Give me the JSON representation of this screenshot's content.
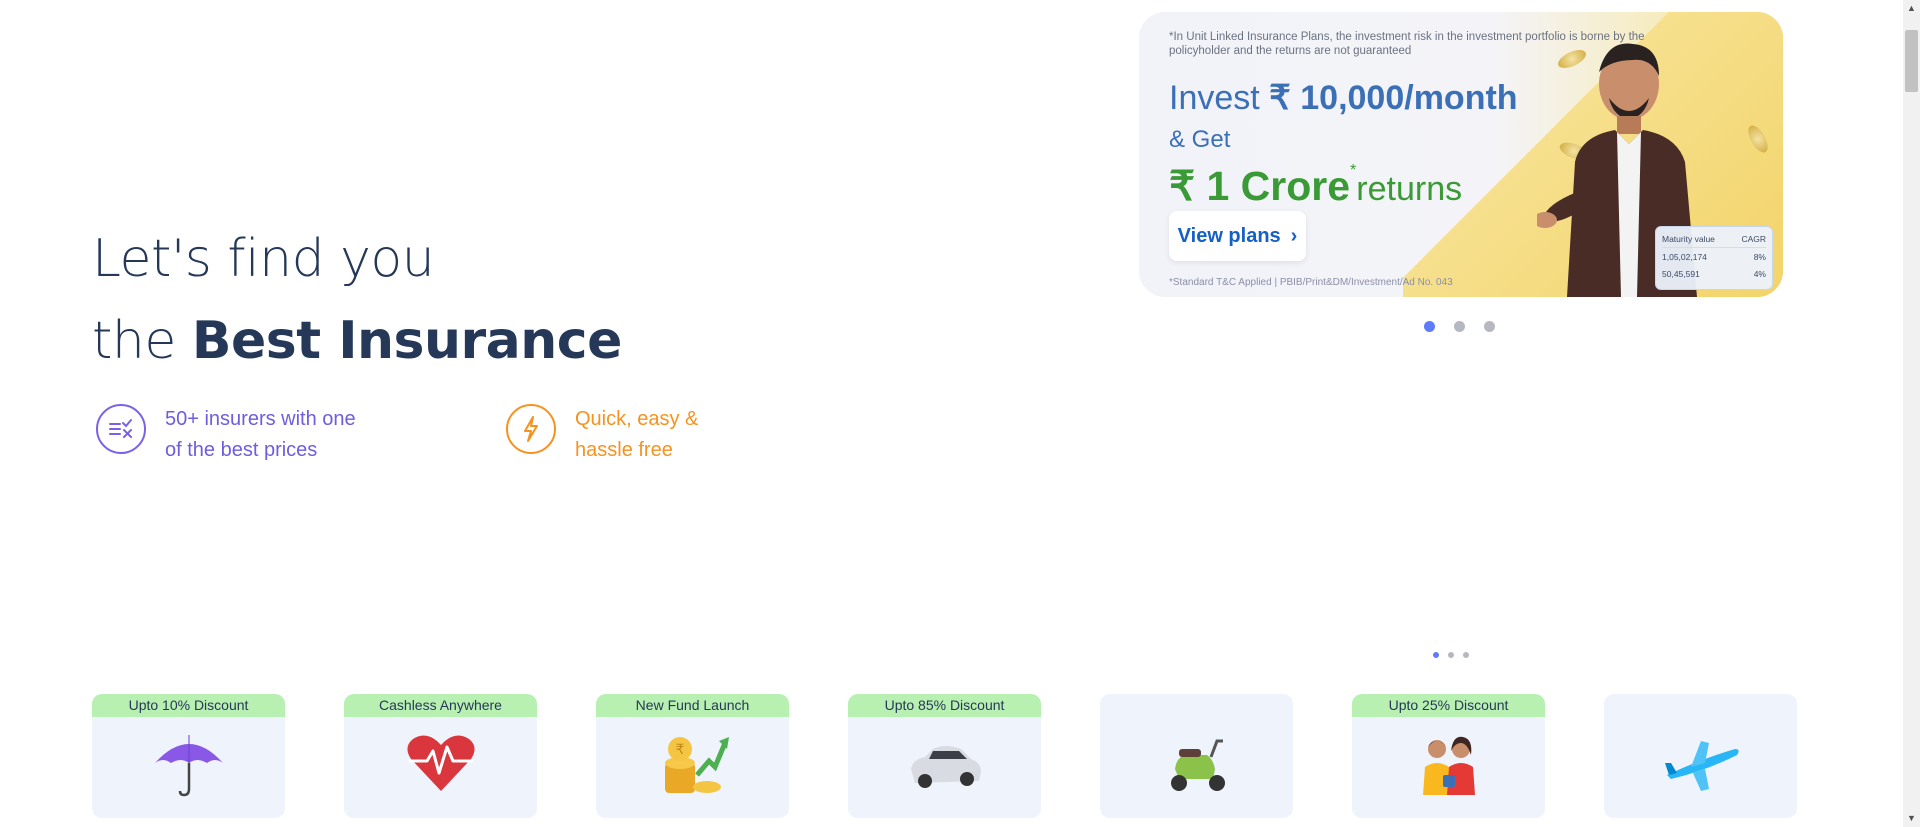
{
  "hero": {
    "line1": "Let's find you",
    "line2_prefix": "the ",
    "line2_bold": "Best Insurance"
  },
  "features": [
    {
      "line1": "50+ insurers with one",
      "line2": "of the best prices",
      "icon": "compare-icon",
      "color": "#6e5ddf"
    },
    {
      "line1": "Quick, easy &",
      "line2": "hassle free",
      "icon": "lightning-icon",
      "color": "#f7921e"
    }
  ],
  "banner": {
    "disclaimer": "*In Unit Linked Insurance Plans, the investment risk in the investment portfolio is borne by the policyholder and the returns are not guaranteed",
    "invest_prefix": "Invest ",
    "invest_amount": "₹ 10,000/month",
    "get": "& Get",
    "crore": "₹ 1 Crore",
    "star": "*",
    "returns": "returns",
    "button": "View plans",
    "button_chevron": "›",
    "fine_print": "*Standard T&C Applied | PBIB/Print&DM/Investment/Ad No. 043",
    "maturity": {
      "col1": "Maturity value",
      "col2": "CAGR",
      "rows": [
        {
          "value": "1,05,02,174",
          "cagr": "8%"
        },
        {
          "value": "50,45,591",
          "cagr": "4%"
        }
      ]
    },
    "slides_total": 3,
    "active_slide": 1
  },
  "product_pager": {
    "pages_total": 3,
    "active_page": 1
  },
  "products": [
    {
      "tag": "Upto 10% Discount",
      "icon": "umbrella-icon"
    },
    {
      "tag": "Cashless Anywhere",
      "icon": "heart-pulse-icon"
    },
    {
      "tag": "New Fund Launch",
      "icon": "coins-growth-icon"
    },
    {
      "tag": "Upto 85% Discount",
      "icon": "car-icon"
    },
    {
      "tag": "",
      "icon": "scooter-icon"
    },
    {
      "tag": "Upto 25% Discount",
      "icon": "family-icon"
    },
    {
      "tag": "",
      "icon": "airplane-icon"
    }
  ],
  "colors": {
    "navy": "#253858",
    "purple": "#6e5ddf",
    "orange": "#f7921e",
    "banner_blue": "#3b6fb6",
    "banner_green": "#3a9a35",
    "tag_green": "#b8f0b1",
    "card_bg": "#eef3fc",
    "dot_active": "#5c7cfa"
  }
}
